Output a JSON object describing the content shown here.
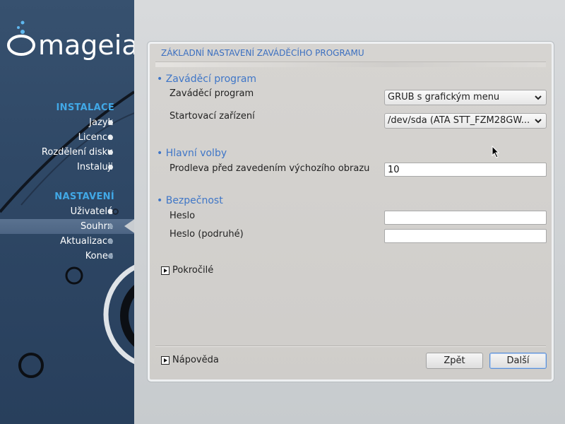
{
  "brand": {
    "logo_text": "mageia"
  },
  "sidebar": {
    "section_install": "INSTALACE",
    "install_steps": [
      {
        "label": "Jazyk"
      },
      {
        "label": "Licence"
      },
      {
        "label": "Rozdělení disku"
      },
      {
        "label": "Instaluji"
      }
    ],
    "section_config": "NASTAVENÍ",
    "config_steps": [
      {
        "label": "Uživatelé"
      },
      {
        "label": "Souhrn"
      },
      {
        "label": "Aktualizace"
      },
      {
        "label": "Konec"
      }
    ],
    "current_step": "Souhrn"
  },
  "panel": {
    "title": "ZÁKLADNÍ NASTAVENÍ ZAVÁDĚCÍHO PROGRAMU",
    "groups": {
      "bootloader": {
        "title": "• Zaváděcí program",
        "bootloader_label": "Zaváděcí program",
        "bootloader_value": "GRUB s grafickým menu",
        "device_label": "Startovací zařízení",
        "device_value": "/dev/sda (ATA STT_FZM28GW..."
      },
      "main_options": {
        "title": "• Hlavní volby",
        "delay_label": "Prodleva před zavedením výchozího obrazu",
        "delay_value": "10"
      },
      "security": {
        "title": "• Bezpečnost",
        "password_label": "Heslo",
        "password_value": "",
        "password2_label": "Heslo (podruhé)",
        "password2_value": ""
      }
    },
    "advanced_label": "Pokročilé",
    "help_label": "Nápověda",
    "back_label": "Zpět",
    "next_label": "Další"
  }
}
